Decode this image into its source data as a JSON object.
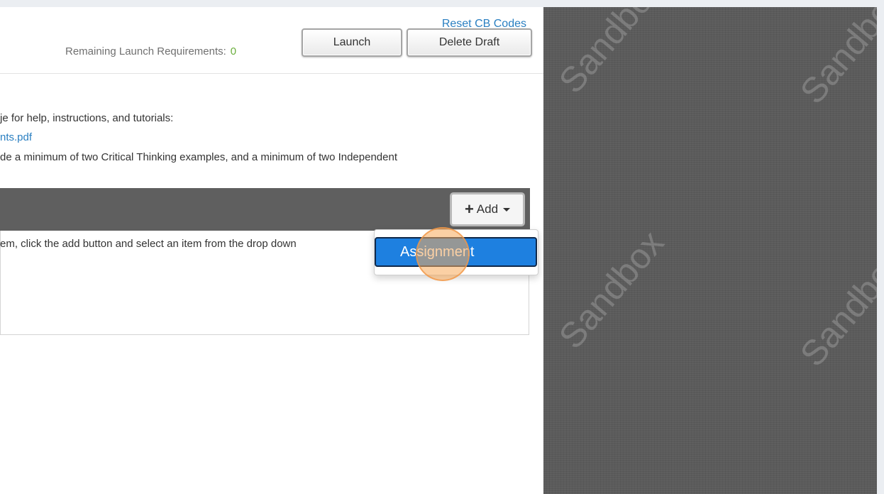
{
  "header": {
    "reset_link": "Reset CB Codes",
    "requirements_label": "Remaining Launch Requirements:",
    "requirements_count": "0",
    "launch_label": "Launch",
    "delete_draft_label": "Delete Draft"
  },
  "content": {
    "help_text": "je for help, instructions, and tutorials:",
    "pdf_link": "nts.pdf",
    "requirement_text": "de a minimum of two Critical Thinking examples, and a minimum of two Independent"
  },
  "section": {
    "add_label": "Add",
    "instruction": "em, click the add button and select an item from the drop down"
  },
  "dropdown": {
    "items": [
      {
        "label": "Assignment"
      }
    ]
  },
  "watermark": {
    "text": "Sandbox",
    "color": "#5b5b5b"
  },
  "colors": {
    "link": "#2a7fc1",
    "count": "#6aae3c",
    "selected_item": "#1e80e0",
    "section_bar": "#5f5f5f"
  }
}
